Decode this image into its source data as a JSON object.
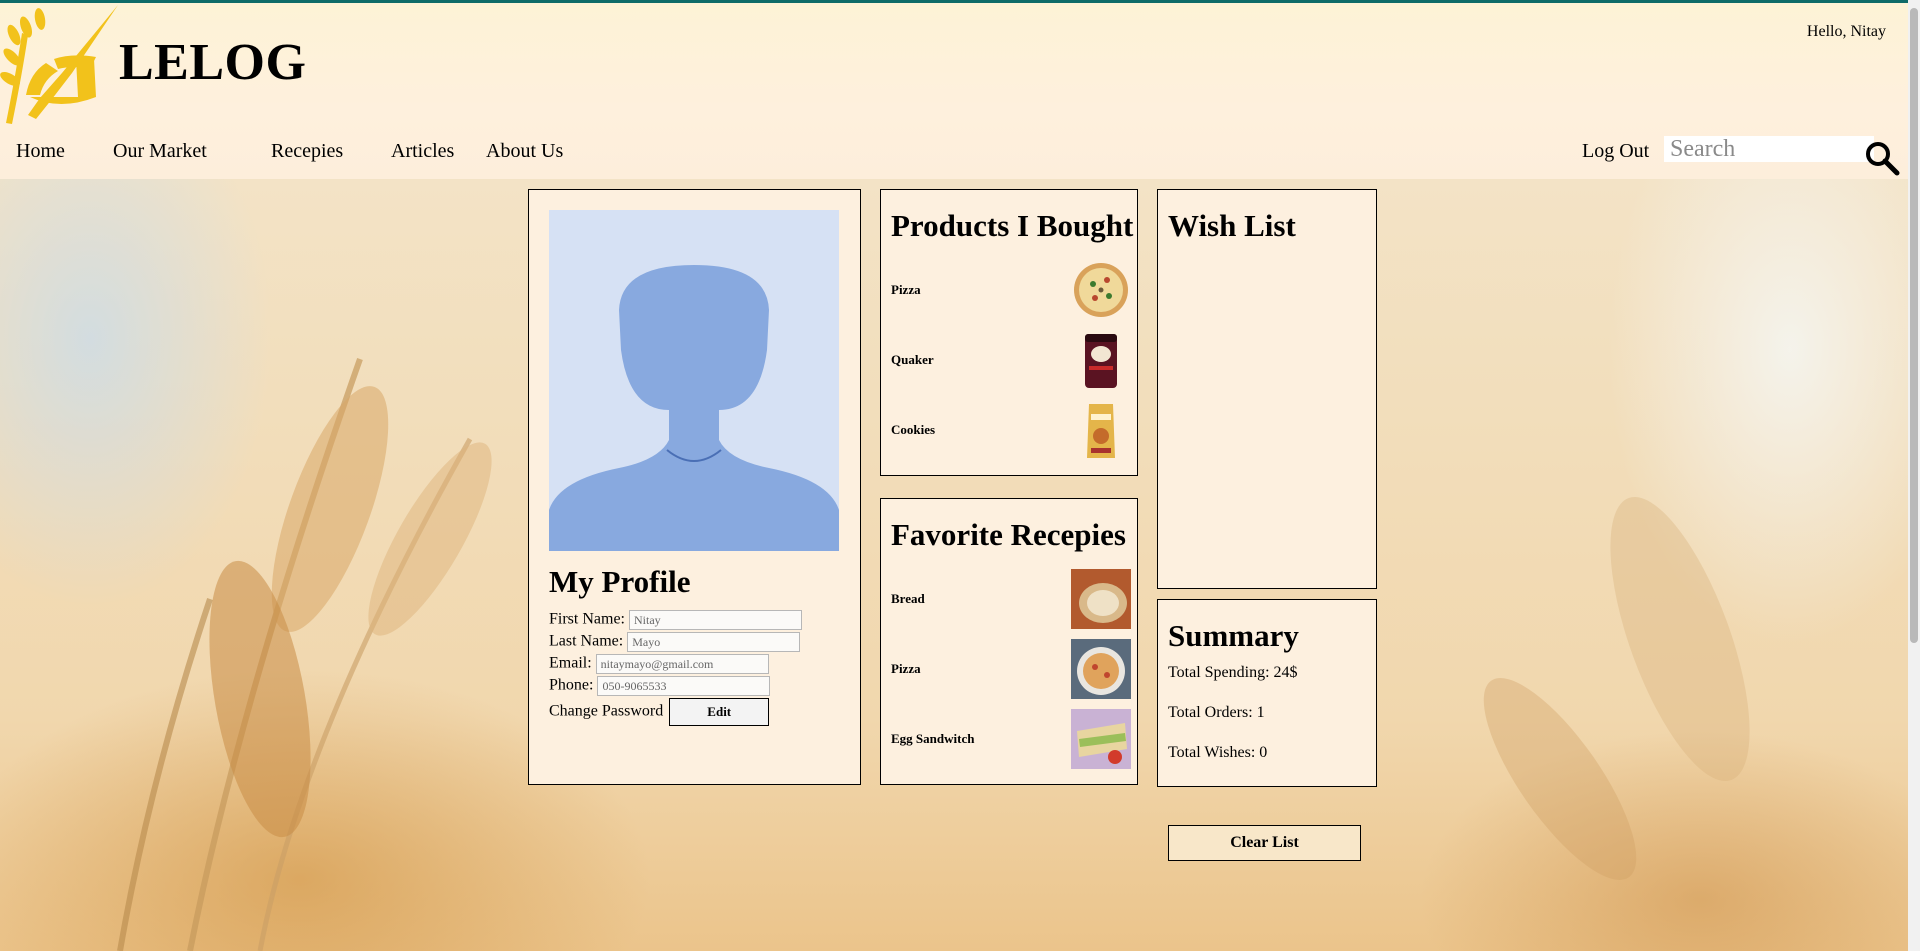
{
  "header": {
    "brand": "LELOG",
    "greeting": "Hello, Nitay",
    "nav": [
      "Home",
      "Our Market",
      "Recepies",
      "Articles",
      "About Us"
    ],
    "logout": "Log Out",
    "search_placeholder": "Search"
  },
  "profile": {
    "title": "My Profile",
    "first_name_label": "First Name:",
    "first_name": "Nitay",
    "last_name_label": "Last Name:",
    "last_name": "Mayo",
    "email_label": "Email:",
    "email": "nitaymayo@gmail.com",
    "phone_label": "Phone:",
    "phone": "050-9065533",
    "change_password_label": "Change Password",
    "edit_label": "Edit"
  },
  "products": {
    "title": "Products I Bought",
    "items": [
      "Pizza",
      "Quaker",
      "Cookies"
    ]
  },
  "recipes": {
    "title": "Favorite Recepies",
    "items": [
      "Bread",
      "Pizza",
      "Egg Sandwitch"
    ]
  },
  "wishlist": {
    "title": "Wish List"
  },
  "summary": {
    "title": "Summary",
    "spending": "Total Spending: 24$",
    "orders": "Total Orders: 1",
    "wishes": "Total Wishes: 0"
  },
  "clear_label": "Clear List",
  "colors": {
    "accent_top": "#0e6b68",
    "logo_gold": "#f2c21b",
    "panel_bg": "#fdf0df"
  }
}
